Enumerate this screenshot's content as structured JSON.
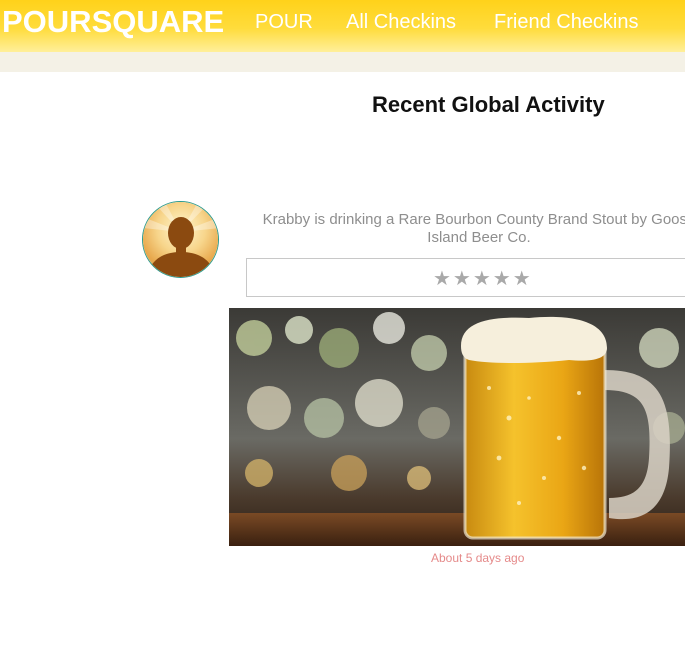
{
  "header": {
    "brand": "POURSQUARE",
    "nav": [
      {
        "label": "POUR"
      },
      {
        "label": "All Checkins"
      },
      {
        "label": "Friend Checkins"
      }
    ]
  },
  "main": {
    "title": "Recent Global Activity",
    "activity": {
      "text": "Krabby is drinking a Rare Bourbon County Brand Stout by Goose Island Beer Co.",
      "rating_stars": "★★★★★",
      "rating_value": 0,
      "rating_max": 5,
      "photo_icon": "beer-mug-photo",
      "timestamp": "About 5 days ago"
    }
  },
  "colors": {
    "header": "#ffd21a",
    "subbar": "#f4f1e6",
    "timestamp": "#e58a8a",
    "avatar_border": "#2c9b8f"
  }
}
